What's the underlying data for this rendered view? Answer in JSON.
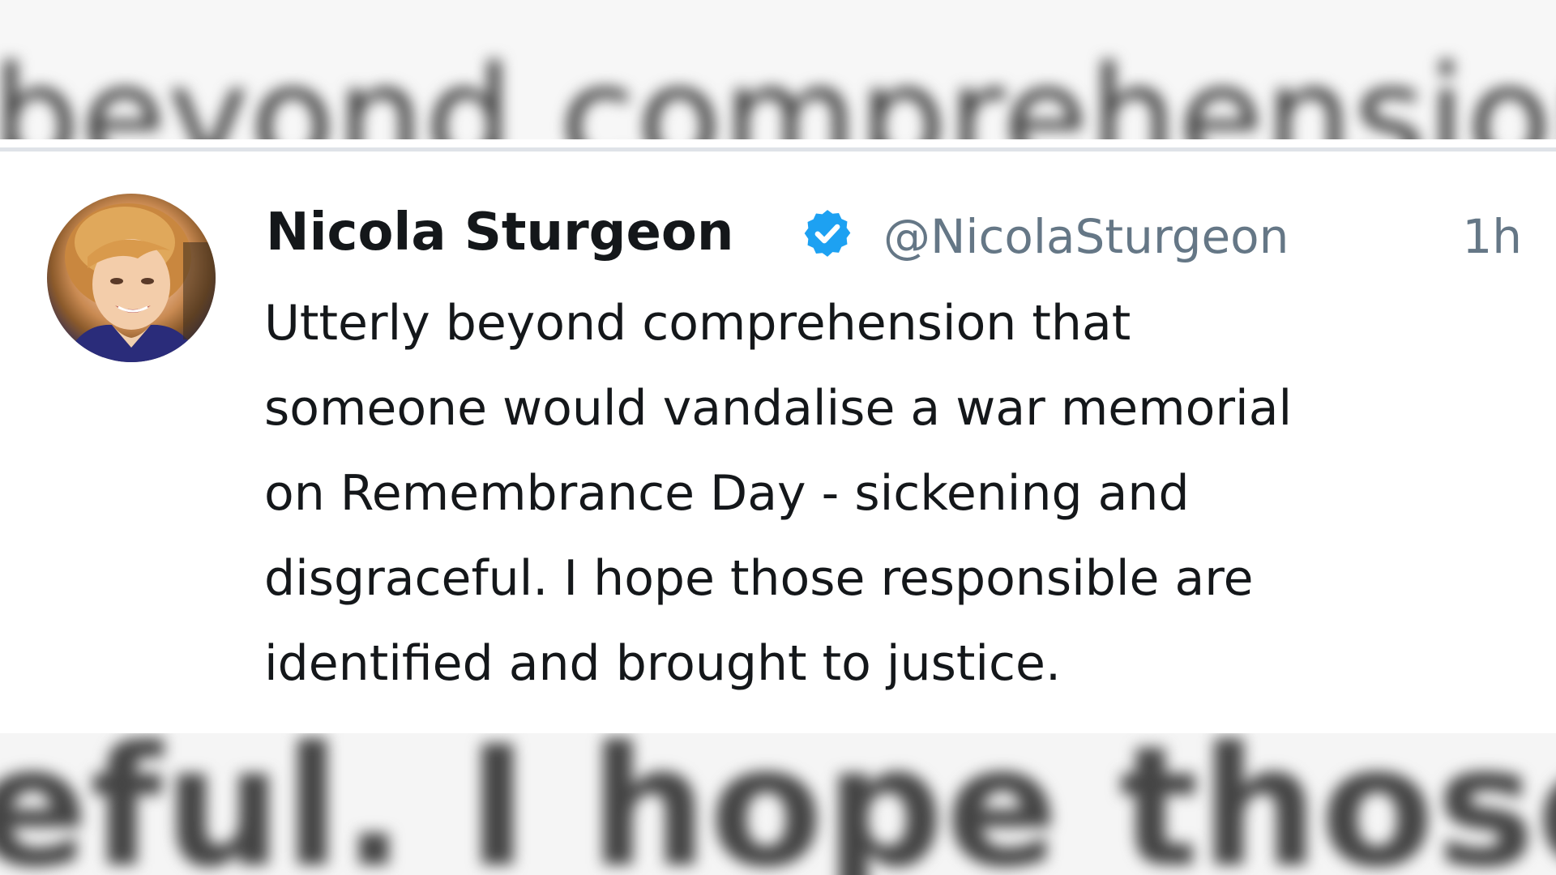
{
  "background": {
    "top_blurred_text": "beyond comprehension",
    "bottom_blurred_text": "eful. I hope those res"
  },
  "tweet": {
    "display_name": "Nicola Sturgeon",
    "handle": "@NicolaSturgeon",
    "timestamp": "1h",
    "verified": true,
    "body_lines": [
      "Utterly beyond comprehension that",
      "someone would vandalise a war memorial",
      "on Remembrance Day - sickening and",
      "disgraceful. I hope those responsible are",
      "identified and brought to justice."
    ]
  },
  "icons": {
    "verified": "verified-badge-icon",
    "avatar": "profile-photo"
  },
  "colors": {
    "name_text": "#14171a",
    "secondary_text": "#657786",
    "verified_blue": "#1da1f2",
    "divider": "#dfe3e8"
  }
}
